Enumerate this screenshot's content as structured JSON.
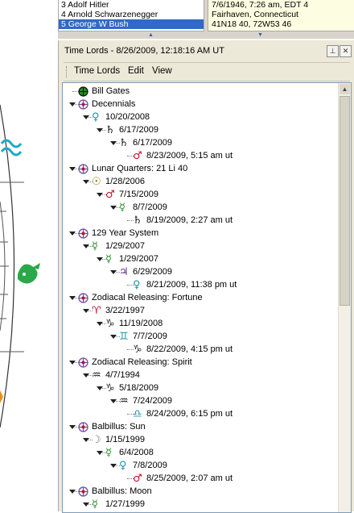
{
  "chart_list": {
    "rows": [
      "3 Adolf Hitler",
      "4 Arnold Schwarzenegger",
      "5 George W Bush"
    ],
    "selected_index": 2
  },
  "chart_info": {
    "lines": [
      "7/6/1946, 7:26 am, EDT 4",
      "Fairhaven, Connecticut",
      "41N18 40, 72W53 46"
    ]
  },
  "panel": {
    "title": "Time Lords - 8/26/2009, 12:18:16 AM UT",
    "pin_icon": "pin-icon",
    "close_icon": "close-icon"
  },
  "menu": [
    "Time Lords",
    "Edit",
    "View"
  ],
  "colors": {
    "selection": "#3169c6",
    "mars": "#c0102a",
    "mercury": "#2a8a2a",
    "venus": "#1e90a8",
    "saturn": "#111111",
    "jupiter": "#5a2a8a"
  },
  "tree": [
    {
      "level": 0,
      "expand": "none",
      "icon": "earth-icon",
      "label": "Bill Gates"
    },
    {
      "level": 0,
      "expand": "down",
      "icon": "globe-icon",
      "label": "Decennials"
    },
    {
      "level": 1,
      "expand": "down",
      "icon": "venus-icon",
      "glyph": "♀",
      "color": "#1e90a8",
      "label": "10/20/2008"
    },
    {
      "level": 2,
      "expand": "down",
      "icon": "saturn-icon",
      "glyph": "♄",
      "color": "#111111",
      "label": "6/17/2009"
    },
    {
      "level": 3,
      "expand": "down",
      "icon": "saturn-icon",
      "glyph": "♄",
      "color": "#111111",
      "label": "6/17/2009"
    },
    {
      "level": 4,
      "expand": "none",
      "icon": "mars-icon",
      "glyph": "♂",
      "color": "#c0102a",
      "label": "8/23/2009, 5:15 am ut"
    },
    {
      "level": 0,
      "expand": "down",
      "icon": "globe-icon",
      "label": "Lunar Quarters: 21 Li 40"
    },
    {
      "level": 1,
      "expand": "down",
      "icon": "sun-icon",
      "glyph": "☉",
      "color": "#8a7a10",
      "label": "1/28/2006"
    },
    {
      "level": 2,
      "expand": "down",
      "icon": "mars-icon",
      "glyph": "♂",
      "color": "#c0102a",
      "label": "7/15/2009"
    },
    {
      "level": 3,
      "expand": "down",
      "icon": "mercury-icon",
      "glyph": "☿",
      "color": "#2a8a2a",
      "label": "8/7/2009"
    },
    {
      "level": 4,
      "expand": "none",
      "icon": "saturn-icon",
      "glyph": "♄",
      "color": "#111111",
      "label": "8/19/2009, 2:27 am ut"
    },
    {
      "level": 0,
      "expand": "down",
      "icon": "globe-icon",
      "label": "129 Year System"
    },
    {
      "level": 1,
      "expand": "down",
      "icon": "mercury-icon",
      "glyph": "☿",
      "color": "#2a8a2a",
      "label": "1/29/2007"
    },
    {
      "level": 2,
      "expand": "down",
      "icon": "mercury-icon",
      "glyph": "☿",
      "color": "#2a8a2a",
      "label": "1/29/2007"
    },
    {
      "level": 3,
      "expand": "down",
      "icon": "jupiter-icon",
      "glyph": "♃",
      "color": "#5a2a8a",
      "label": "6/29/2009"
    },
    {
      "level": 4,
      "expand": "none",
      "icon": "venus-icon",
      "glyph": "♀",
      "color": "#1e90a8",
      "label": "8/21/2009, 11:38 pm ut"
    },
    {
      "level": 0,
      "expand": "down",
      "icon": "globe-icon",
      "label": "Zodiacal Releasing: Fortune"
    },
    {
      "level": 1,
      "expand": "down",
      "icon": "aries-icon",
      "glyph": "♈",
      "color": "#c0102a",
      "label": "3/22/1997"
    },
    {
      "level": 2,
      "expand": "down",
      "icon": "capricorn-icon",
      "glyph": "♑",
      "color": "#333333",
      "label": "11/19/2008"
    },
    {
      "level": 3,
      "expand": "down",
      "icon": "gemini-icon",
      "glyph": "♊",
      "color": "#1e90a8",
      "label": "7/7/2009"
    },
    {
      "level": 4,
      "expand": "none",
      "icon": "capricorn-icon",
      "glyph": "♑",
      "color": "#333333",
      "label": "8/22/2009, 4:15 pm ut"
    },
    {
      "level": 0,
      "expand": "down",
      "icon": "globe-icon",
      "label": "Zodiacal Releasing: Spirit"
    },
    {
      "level": 1,
      "expand": "down",
      "icon": "aquarius-icon",
      "glyph": "♒",
      "color": "#111111",
      "label": "4/7/1994"
    },
    {
      "level": 2,
      "expand": "down",
      "icon": "capricorn-icon",
      "glyph": "♑",
      "color": "#333333",
      "label": "5/18/2009"
    },
    {
      "level": 3,
      "expand": "down",
      "icon": "aquarius-icon",
      "glyph": "♒",
      "color": "#111111",
      "label": "7/24/2009"
    },
    {
      "level": 4,
      "expand": "none",
      "icon": "libra-icon",
      "glyph": "♎",
      "color": "#1e90a8",
      "label": "8/24/2009, 6:15 pm ut"
    },
    {
      "level": 0,
      "expand": "down",
      "icon": "globe-icon",
      "label": "Balbillus: Sun"
    },
    {
      "level": 1,
      "expand": "down",
      "icon": "moon-icon",
      "glyph": "☽",
      "color": "#777777",
      "label": "1/15/1999"
    },
    {
      "level": 2,
      "expand": "down",
      "icon": "mercury-icon",
      "glyph": "☿",
      "color": "#2a8a2a",
      "label": "6/4/2008"
    },
    {
      "level": 3,
      "expand": "down",
      "icon": "venus-icon",
      "glyph": "♀",
      "color": "#1e90a8",
      "label": "7/8/2009"
    },
    {
      "level": 4,
      "expand": "none",
      "icon": "mars-icon",
      "glyph": "♂",
      "color": "#c0102a",
      "label": "8/25/2009, 2:07 am ut"
    },
    {
      "level": 0,
      "expand": "down",
      "icon": "globe-icon",
      "label": "Balbillus: Moon"
    },
    {
      "level": 1,
      "expand": "down",
      "icon": "mercury-icon",
      "glyph": "☿",
      "color": "#2a8a2a",
      "label": "1/27/1999"
    }
  ]
}
